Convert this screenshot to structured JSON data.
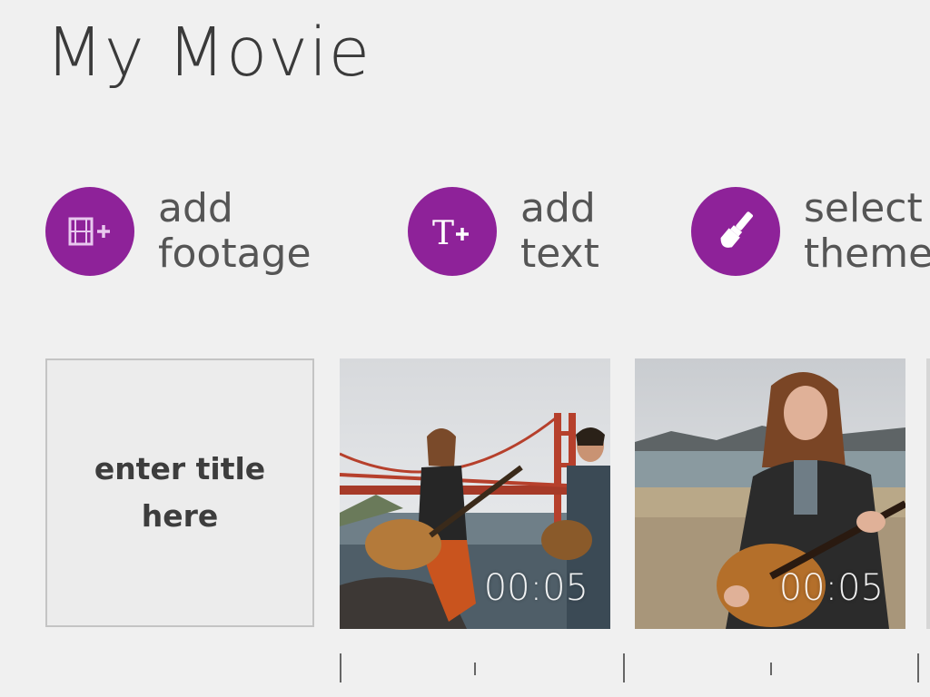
{
  "header": {
    "title": "My Movie"
  },
  "actions": [
    {
      "line1": "add",
      "line2": "footage",
      "icon": "film-add-icon"
    },
    {
      "line1": "add",
      "line2": "text",
      "icon": "text-add-icon"
    },
    {
      "line1": "select",
      "line2": "theme",
      "icon": "paintbrush-icon"
    }
  ],
  "timeline": {
    "title_tile": {
      "placeholder": "enter title here"
    },
    "clips": [
      {
        "duration": "00:05",
        "description": "two musicians with guitars in front of Golden Gate Bridge"
      },
      {
        "duration": "00:05",
        "description": "woman playing guitar on a beach"
      }
    ]
  },
  "colors": {
    "accent": "#8e2299",
    "background": "#f0f0f0",
    "text": "#3a3a3a"
  }
}
